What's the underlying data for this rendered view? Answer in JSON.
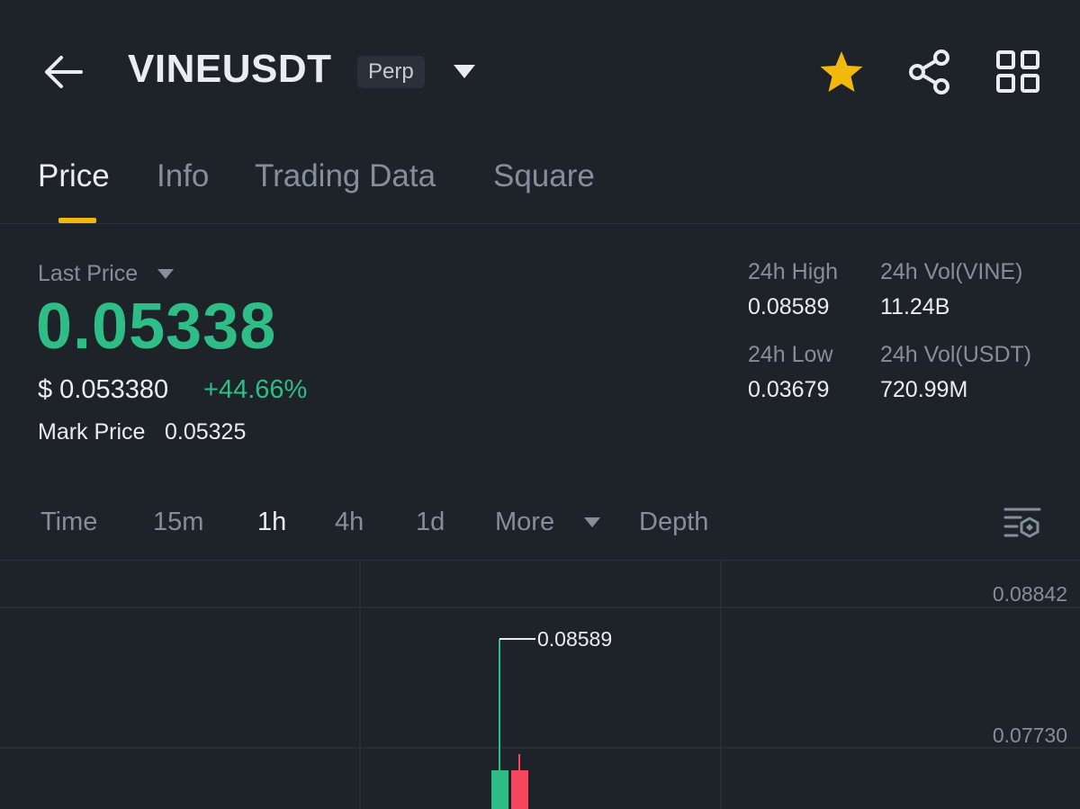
{
  "header": {
    "back_icon": "arrow-left-icon",
    "symbol": "VINEUSDT",
    "contract_type": "Perp",
    "icons": [
      "star-icon",
      "share-icon",
      "grid-icon"
    ],
    "star_color": "#f0b90b"
  },
  "tabs": [
    {
      "label": "Price",
      "active": true
    },
    {
      "label": "Info",
      "active": false
    },
    {
      "label": "Trading Data",
      "active": false
    },
    {
      "label": "Square",
      "active": false
    }
  ],
  "price": {
    "last_price_label": "Last Price",
    "last_price": "0.05338",
    "usd_price": "$ 0.053380",
    "change_pct": "+44.66%",
    "mark_price_label": "Mark Price",
    "mark_price": "0.05325",
    "up_color": "#2ebd85"
  },
  "stats": {
    "high_label": "24h High",
    "high_value": "0.08589",
    "vol_vine_label": "24h Vol(VINE)",
    "vol_vine_value": "11.24B",
    "low_label": "24h Low",
    "low_value": "0.03679",
    "vol_usdt_label": "24h Vol(USDT)",
    "vol_usdt_value": "720.99M"
  },
  "intervals": {
    "time": "Time",
    "m15": "15m",
    "h1": "1h",
    "h4": "4h",
    "d1": "1d",
    "more": "More",
    "depth": "Depth",
    "active": "1h"
  },
  "chart_data": {
    "type": "candlestick",
    "y_ticks": [
      "0.08842",
      "0.07730"
    ],
    "high_marker": "0.08589",
    "candles": [
      {
        "direction": "up",
        "high": 0.08589,
        "color": "#2ebd85"
      },
      {
        "direction": "down",
        "color": "#f6465d"
      }
    ]
  }
}
